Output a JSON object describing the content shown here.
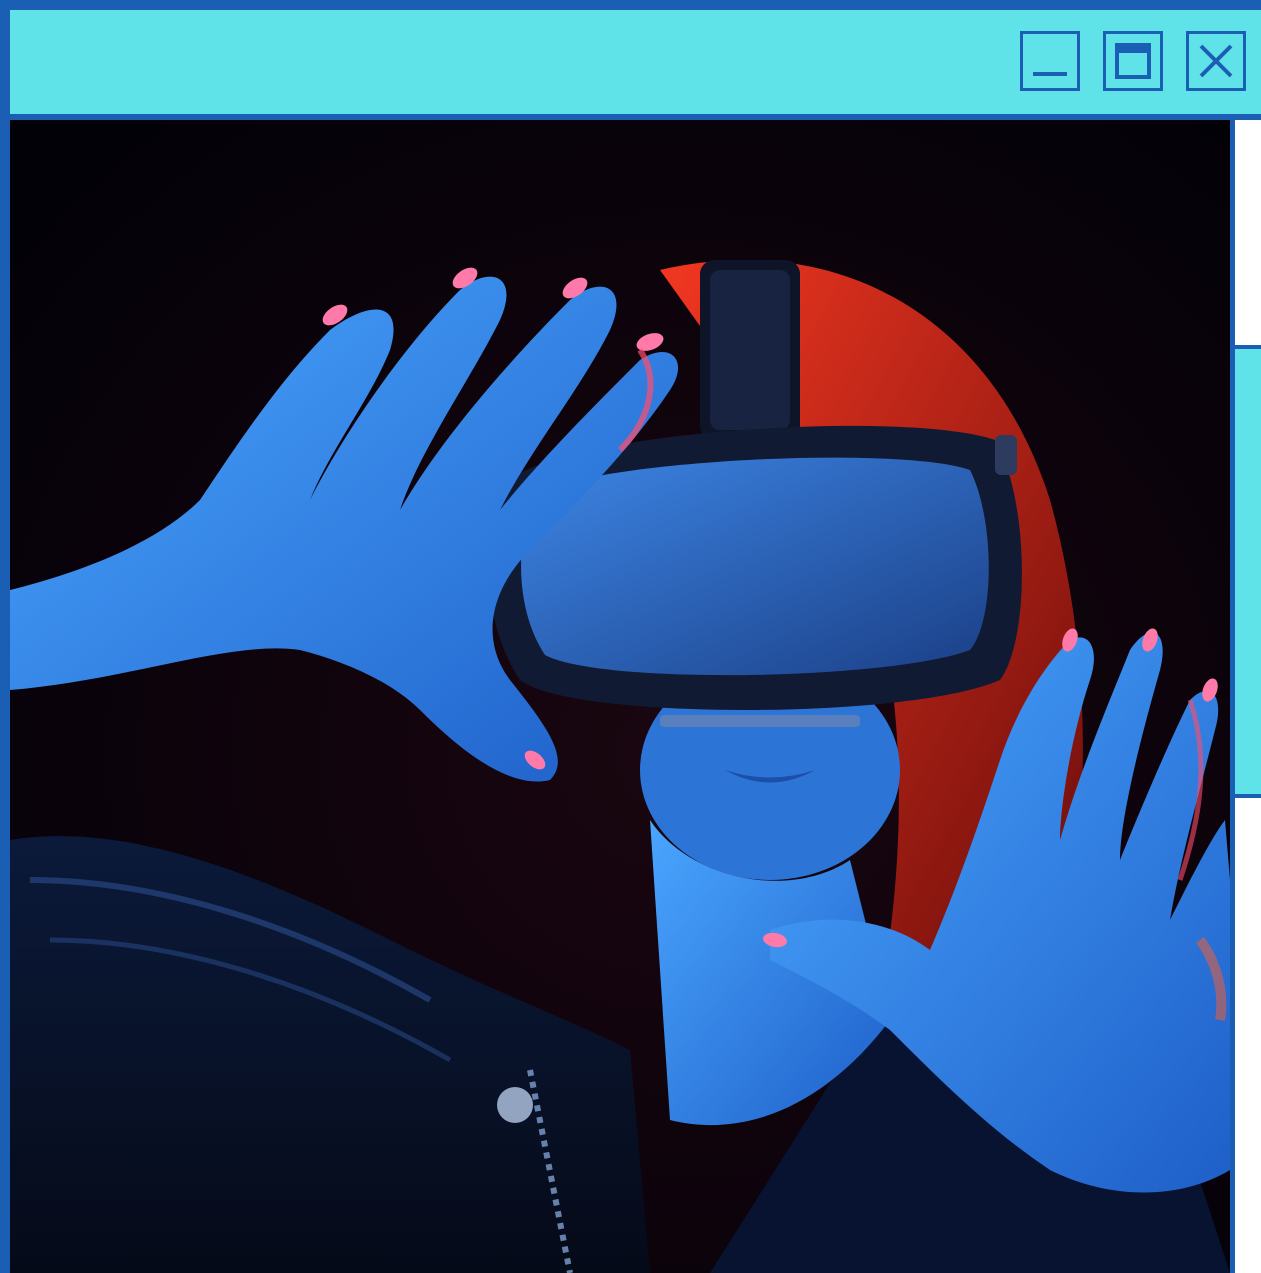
{
  "window": {
    "title": "",
    "controls": {
      "minimize_icon": "minimize-icon",
      "maximize_icon": "maximize-icon",
      "close_icon": "close-icon"
    }
  },
  "content": {
    "image_subject_icon": "vr-headset-photo"
  },
  "colors": {
    "titlebar": "#5fe3e8",
    "border": "#1a5fb4",
    "photo_background": "#05020a",
    "skin_blue": "#3f8fe8",
    "hair_red": "#d9321f",
    "nail_pink": "#ff7aa8"
  }
}
